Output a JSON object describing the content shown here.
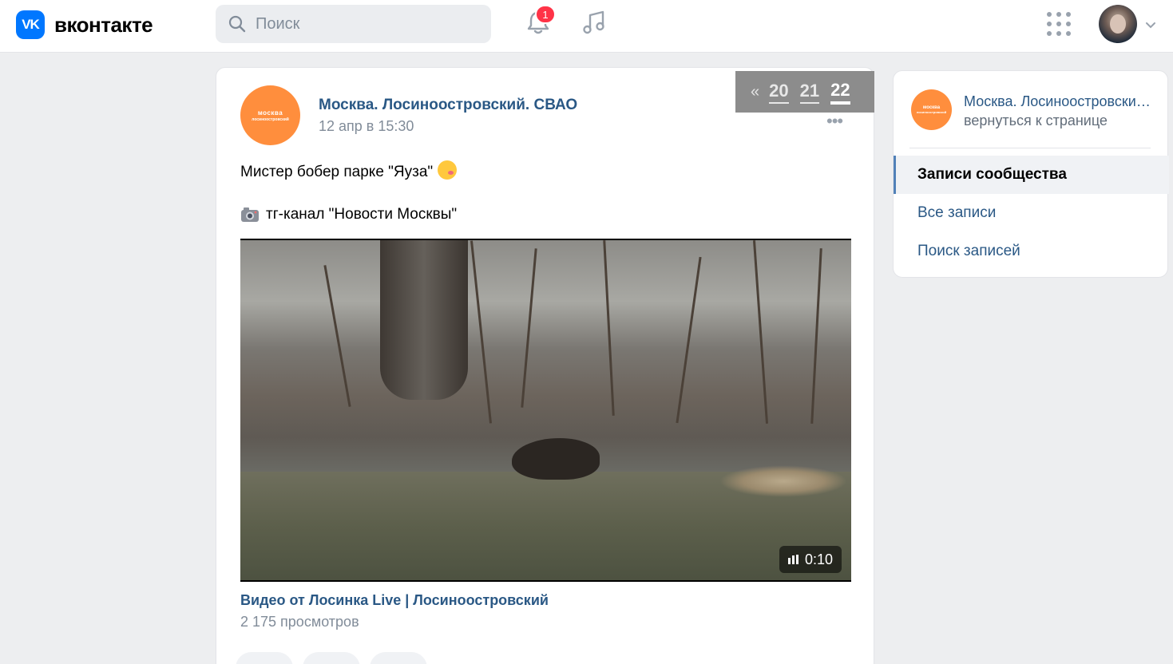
{
  "header": {
    "logo_mark": "VK",
    "logo_text": "вконтакте",
    "search_placeholder": "Поиск",
    "notifications_count": "1"
  },
  "post": {
    "author": "Москва. Лосиноостровский. СВАО",
    "date": "12 апр в 15:30",
    "avatar_line1": "москва",
    "avatar_line2": "лосиноостровский",
    "text_line1": "Мистер бобер парке \"Яуза\"",
    "text_line2": "тг-канал \"Новости Москвы\"",
    "more": "•••",
    "video": {
      "duration": "0:10",
      "title": "Видео от Лосинка Live | Лосиноостровский",
      "views": "2 175 просмотров"
    }
  },
  "pager": {
    "arrow": "«",
    "pages": [
      "20",
      "21",
      "22"
    ],
    "active_page": "22"
  },
  "sidebar": {
    "community_name": "Москва. Лосиноостровский. СВАО",
    "back_label": "вернуться к странице",
    "avatar_line1": "москва",
    "avatar_line2": "лосиноостровский",
    "items": [
      {
        "label": "Записи сообщества",
        "active": true
      },
      {
        "label": "Все записи",
        "active": false
      },
      {
        "label": "Поиск записей",
        "active": false
      }
    ]
  },
  "colors": {
    "accent": "#0077ff",
    "link": "#2a5885",
    "community_avatar": "#ff8e3d",
    "badge": "#ff3347"
  }
}
